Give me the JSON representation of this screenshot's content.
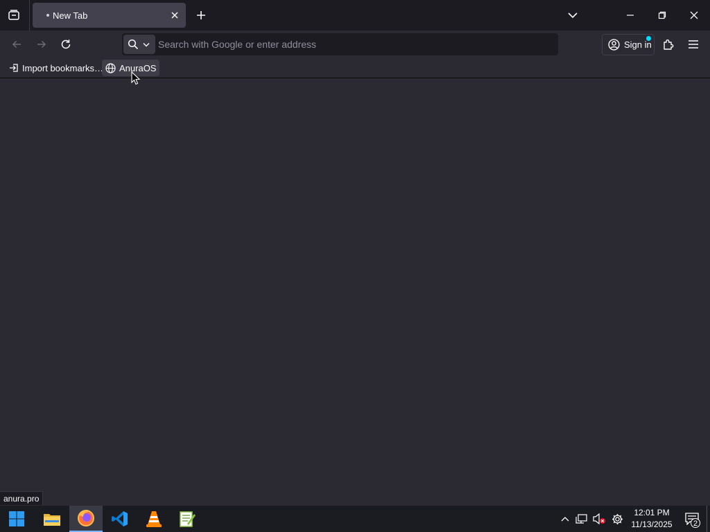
{
  "browser": {
    "tab": {
      "title": "New Tab"
    },
    "urlbar": {
      "placeholder": "Search with Google or enter address",
      "value": ""
    },
    "account": {
      "sign_in_label": "Sign in"
    },
    "bookmarks": [
      {
        "label": "Import bookmarks…",
        "icon": "import-icon"
      },
      {
        "label": "AnuraOS",
        "icon": "globe-icon"
      }
    ],
    "status_url": "anura.pro"
  },
  "taskbar": {
    "apps": [
      {
        "name": "Start",
        "icon": "windows-icon"
      },
      {
        "name": "File Explorer",
        "icon": "folder-icon"
      },
      {
        "name": "Firefox",
        "icon": "firefox-icon",
        "active": true
      },
      {
        "name": "Visual Studio Code",
        "icon": "vscode-icon"
      },
      {
        "name": "VLC",
        "icon": "vlc-icon"
      },
      {
        "name": "Notepad++",
        "icon": "notepad-icon"
      }
    ],
    "clock": {
      "time": "12:01 PM",
      "date": "11/13/2025"
    },
    "notification_count": "2"
  },
  "colors": {
    "tab_strip": "#1c1b22",
    "toolbar": "#2b2a33",
    "selected_tab": "#42414d",
    "taskbar": "#1b1c22",
    "accent": "#00ddff"
  }
}
